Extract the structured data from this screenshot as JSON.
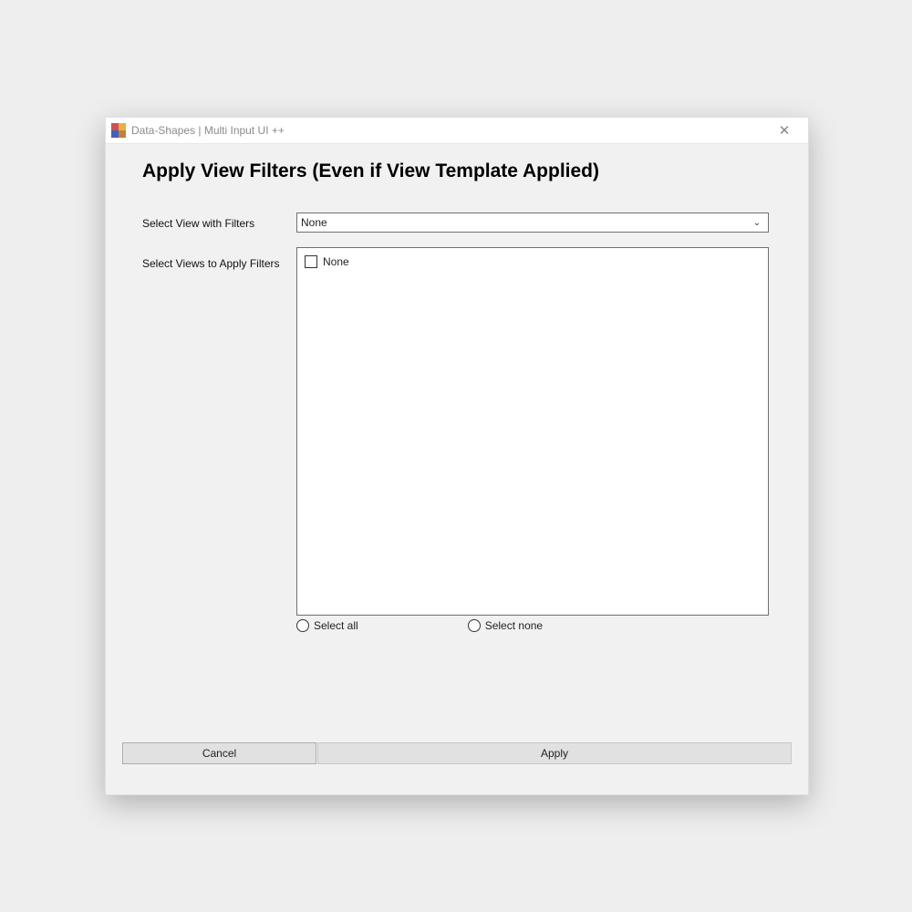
{
  "window": {
    "title": "Data-Shapes | Multi Input UI ++"
  },
  "heading": "Apply View Filters (Even if View Template Applied)",
  "labels": {
    "select_view_with_filters": "Select View with Filters",
    "select_views_to_apply": "Select Views to Apply Filters"
  },
  "dropdown": {
    "selected": "None"
  },
  "listbox": {
    "items": [
      {
        "label": "None",
        "checked": false
      }
    ]
  },
  "radios": {
    "select_all": "Select all",
    "select_none": "Select none"
  },
  "buttons": {
    "cancel": "Cancel",
    "apply": "Apply"
  }
}
